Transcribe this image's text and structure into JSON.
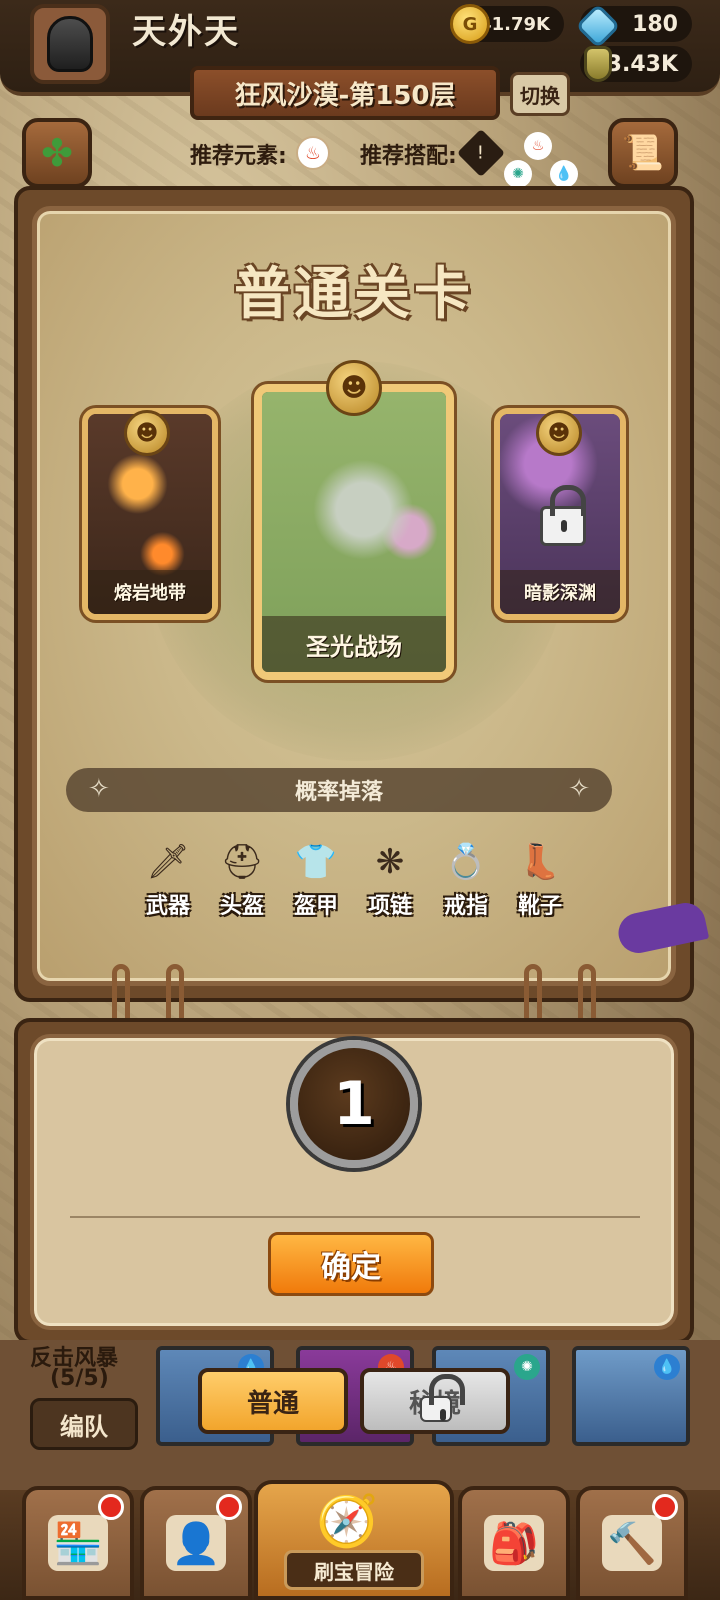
{
  "player": {
    "name": "天外天"
  },
  "currencies": {
    "coins": "141.79K",
    "gems": "180",
    "potions": "3.43K"
  },
  "stage": {
    "label": "狂风沙漠-第150层",
    "switch_label": "切换",
    "recommended_element_label": "推荐元素:",
    "recommended_combo_label": "推荐搭配:"
  },
  "panel": {
    "title": "普通关卡",
    "stages": [
      {
        "name": "熔岩地带",
        "locked": false
      },
      {
        "name": "圣光战场",
        "locked": false,
        "selected": true
      },
      {
        "name": "暗影深渊",
        "locked": true
      }
    ],
    "drop_title": "概率掉落",
    "loot": [
      "武器",
      "头盔",
      "盔甲",
      "项链",
      "戒指",
      "靴子"
    ]
  },
  "quantity": {
    "value": "1",
    "confirm_label": "确定"
  },
  "team": {
    "storm_text": "反击风暴",
    "storm_count": "(5/5)",
    "formation_label": "编队",
    "mode_normal": "普通",
    "mode_hard": "秘境"
  },
  "nav": {
    "active_label": "刷宝冒险"
  },
  "colors": {
    "accent_orange": "#f07a0b",
    "panel_brown": "#6d4a2a",
    "parchment": "#d9c5a0"
  }
}
